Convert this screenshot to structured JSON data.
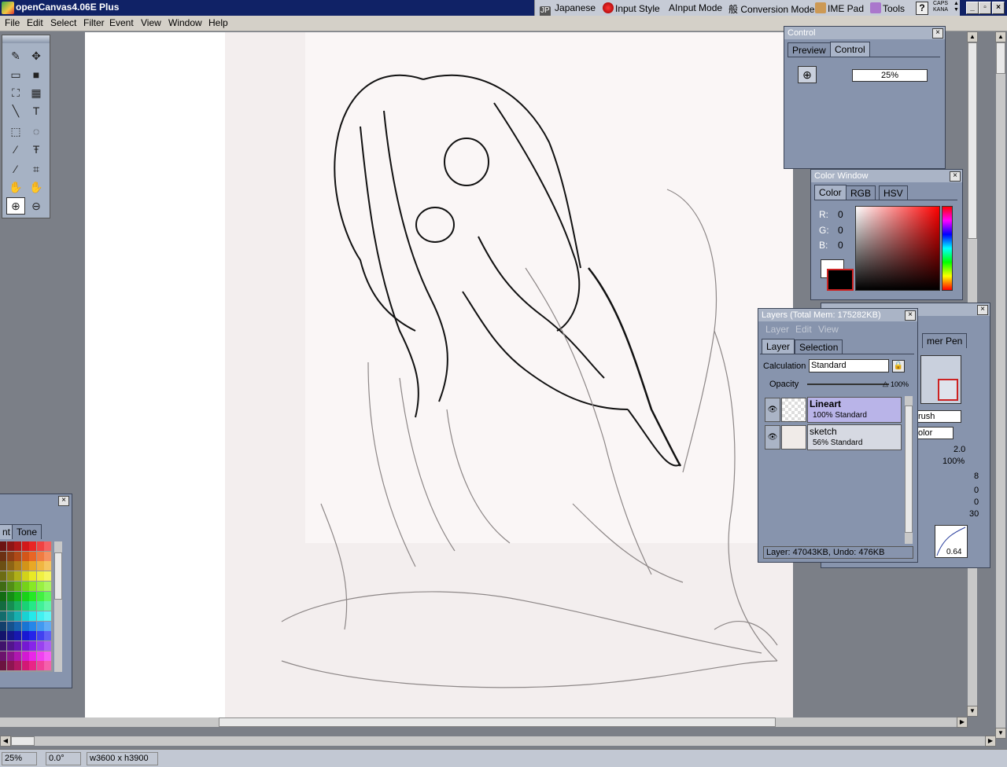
{
  "window": {
    "title": "openCanvas4.06E Plus"
  },
  "ime": {
    "language": "Japanese",
    "lang_code": "JP",
    "input_style": "Input Style",
    "input_mode": "Input Mode",
    "conversion_mode": "Conversion Mode",
    "ime_pad": "IME Pad",
    "tools": "Tools",
    "help": "?",
    "caps": "CAPS",
    "kana": "KANA"
  },
  "menu": [
    "File",
    "Edit",
    "Select",
    "Filter",
    "Event",
    "View",
    "Window",
    "Help"
  ],
  "control_panel": {
    "title": "Control",
    "tabs": [
      "Preview",
      "Control"
    ],
    "active_tab": "Control",
    "zoom_value": "25%"
  },
  "color_window": {
    "title": "Color Window",
    "tabs": [
      "Color",
      "RGB",
      "HSV"
    ],
    "active_tab": "Color",
    "r_label": "R:",
    "r": "0",
    "g_label": "G:",
    "g": "0",
    "b_label": "B:",
    "b": "0",
    "foreground": "#000000",
    "background": "#ffffff"
  },
  "layers": {
    "title": "Layers (Total Mem: 175282KB)",
    "menu": [
      "Layer",
      "Edit",
      "View"
    ],
    "tabs": [
      "Layer",
      "Selection"
    ],
    "active_tab": "Layer",
    "calculation_label": "Calculation",
    "calculation_value": "Standard",
    "opacity_label": "Opacity",
    "opacity_value": "100%",
    "items": [
      {
        "name": "Lineart",
        "detail": "100% Standard",
        "selected": true
      },
      {
        "name": "sketch",
        "detail": "56% Standard",
        "selected": false
      }
    ],
    "status": "Layer: 47043KB, Undo: 476KB"
  },
  "brush_panel": {
    "tab_partial": "mer Pen",
    "brush_field": "rush",
    "color_field": "olor",
    "values": [
      "2.0",
      "100%",
      "8",
      "0",
      "0",
      "30"
    ],
    "curve_value": "0.64"
  },
  "palette_panel": {
    "tabs": [
      "nt",
      "Tone"
    ],
    "active_tab": "nt"
  },
  "status_bar": {
    "zoom": "25%",
    "angle": "0.0°",
    "size": "w3600 x h3900"
  }
}
